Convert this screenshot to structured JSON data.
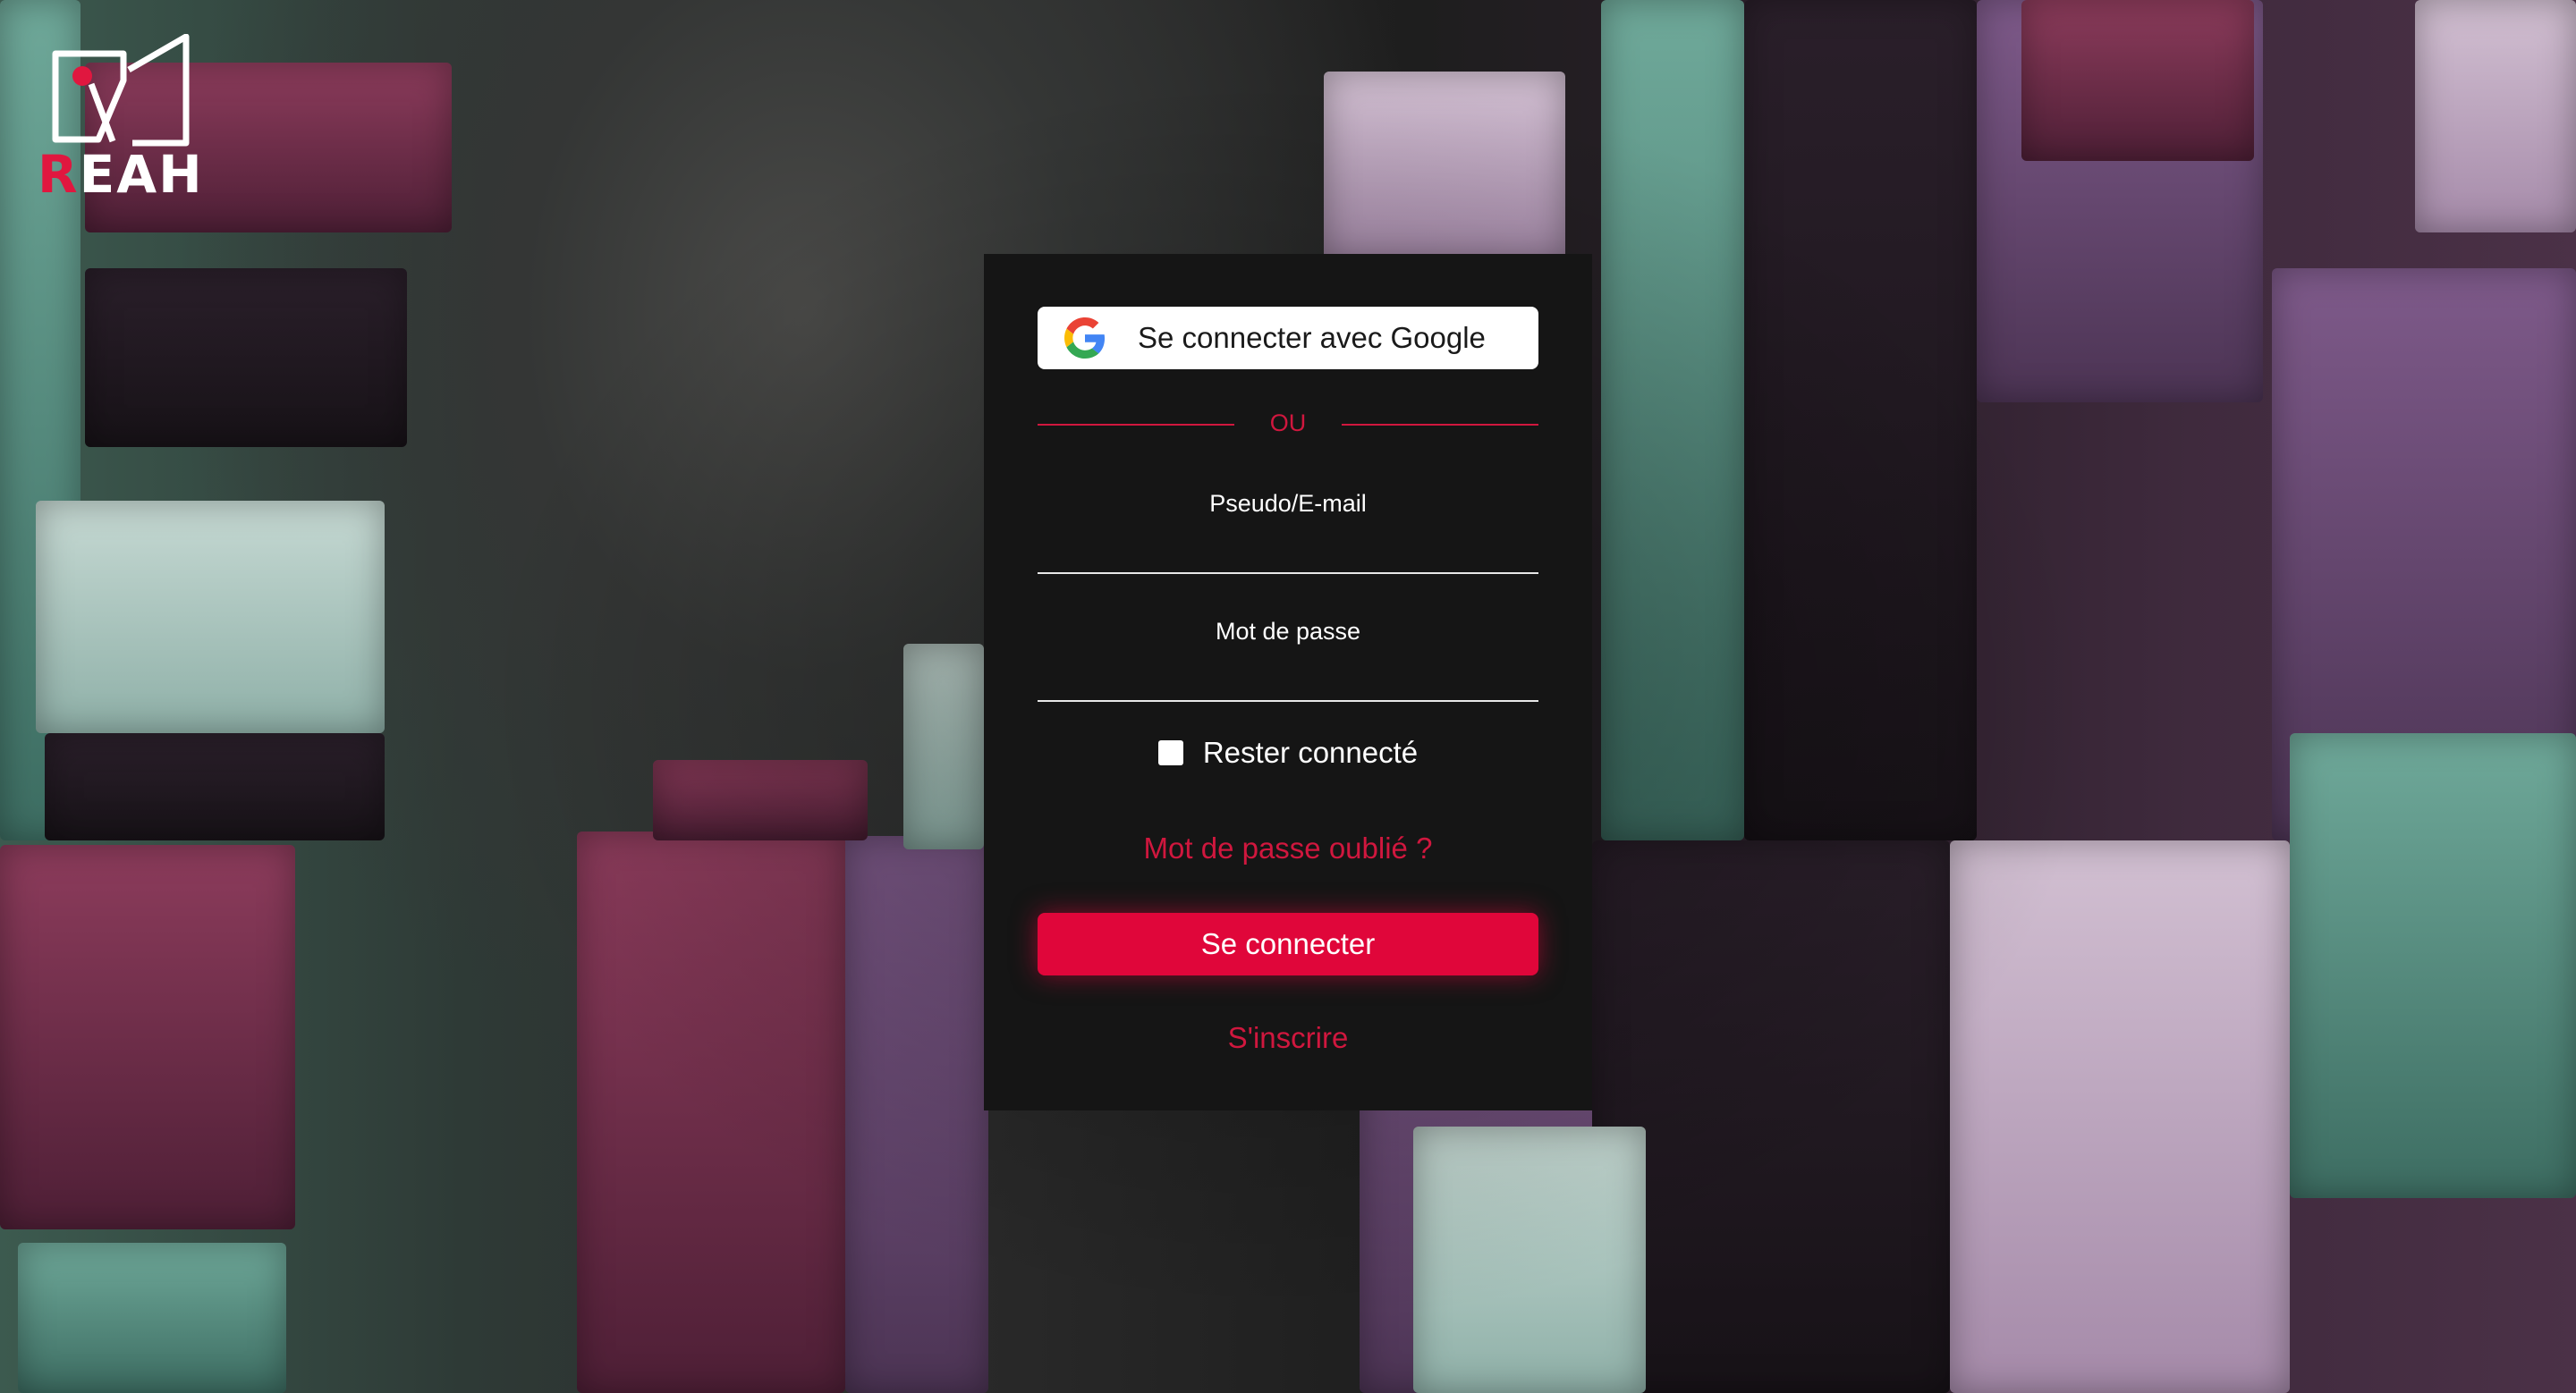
{
  "brand": {
    "logo_icon": "reah-logo-icon",
    "logo_prefix": "R",
    "logo_rest": "EAH",
    "accent_color": "#e0063a"
  },
  "login": {
    "google_button_label": "Se connecter avec Google",
    "google_icon": "google-g-icon",
    "separator_text": "OU",
    "username_label": "Pseudo/E-mail",
    "username_value": "",
    "password_label": "Mot de passe",
    "password_value": "",
    "remember_label": "Rester connecté",
    "remember_checked": false,
    "forgot_link": "Mot de passe oublié ?",
    "submit_label": "Se connecter",
    "signup_link": "S'inscrire"
  },
  "colors": {
    "card_background": "#151515",
    "link_color": "#d0173e",
    "submit_background": "#e0063a"
  }
}
